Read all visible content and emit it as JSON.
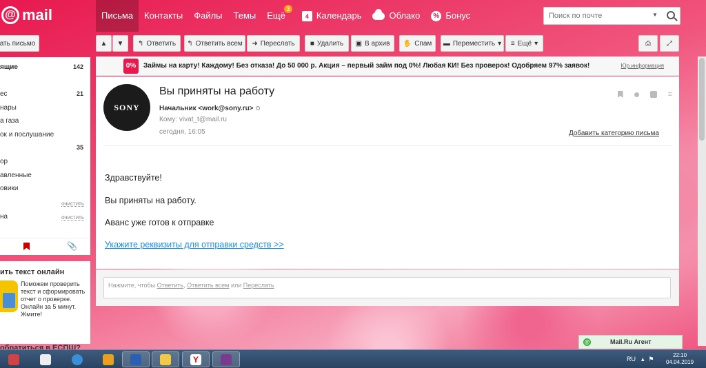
{
  "header": {
    "logo_text": "mail",
    "nav": [
      {
        "label": "Письма"
      },
      {
        "label": "Контакты"
      },
      {
        "label": "Файлы"
      },
      {
        "label": "Темы"
      },
      {
        "label": "Ещё",
        "badge": "3"
      },
      {
        "label": "Календарь",
        "icon": "calendar-icon",
        "icon_text": "4"
      },
      {
        "label": "Облако",
        "icon": "cloud-icon"
      },
      {
        "label": "Бонус",
        "icon": "bonus-icon"
      }
    ],
    "search_placeholder": "Поиск по почте"
  },
  "toolbar": {
    "compose_label": "ать письмо",
    "reply_label": "Ответить",
    "reply_all_label": "Ответить всем",
    "forward_label": "Переслать",
    "delete_label": "Удалить",
    "archive_label": "В архив",
    "spam_label": "Спам",
    "move_label": "Переместить",
    "more_label": "Ещё"
  },
  "sidebar": {
    "items": [
      {
        "label": "ящие",
        "count": "142",
        "bold": true
      },
      {
        "label": "ес",
        "count": "21",
        "bold": false
      },
      {
        "label": "нары",
        "count": "",
        "bold": false
      },
      {
        "label": "а газа",
        "count": "",
        "bold": false
      },
      {
        "label": "ок и послушание",
        "count": "",
        "bold": false
      },
      {
        "label": "",
        "count": "35",
        "bold": false
      },
      {
        "label": "ор",
        "count": "",
        "bold": false
      },
      {
        "label": "авленные",
        "count": "",
        "bold": false
      },
      {
        "label": "овики",
        "count": "",
        "bold": false
      },
      {
        "label": "на",
        "count": "",
        "bold": false
      }
    ],
    "clear_label": "очистить"
  },
  "ad": {
    "title": "ить текст онлайн",
    "text": "Поможем проверить текст и сформировать отчет о проверке. Онлайн за 5 минут. Жмите!",
    "title2": "обратиться в ЕСПШ?"
  },
  "banner": {
    "logo_text": "0%",
    "text": "Займы на карту! Каждому! Без отказа! До 50 000 р. Акция – первый займ под 0%! Любая КИ! Без проверок! Одобряем 97% заявок!",
    "link": "Юр.информация"
  },
  "letter": {
    "avatar_text": "SONY",
    "subject": "Вы приняты на работу",
    "from": "Начальник <work@sony.ru>",
    "to": "Кому: vivat_t@mail.ru",
    "time": "сегодня, 16:05",
    "add_category": "Добавить категорию письма",
    "body": [
      "Здравствуйте!",
      "Вы приняты на работу.",
      "Аванс уже готов к отправке"
    ],
    "link": "Укажите реквизиты для отправки средств >>"
  },
  "reply": {
    "prefix": "Нажмите, чтобы ",
    "reply": "Ответить",
    "sep": ", ",
    "reply_all": "Ответить всем",
    "or": " или ",
    "forward": "Переслать"
  },
  "agent": {
    "label": "Mail.Ru Агент"
  },
  "taskbar": {
    "lang": "RU",
    "time": "22:10",
    "date": "04.04.2019"
  },
  "colors": {
    "brand": "#e8194f",
    "link": "#168de2"
  }
}
